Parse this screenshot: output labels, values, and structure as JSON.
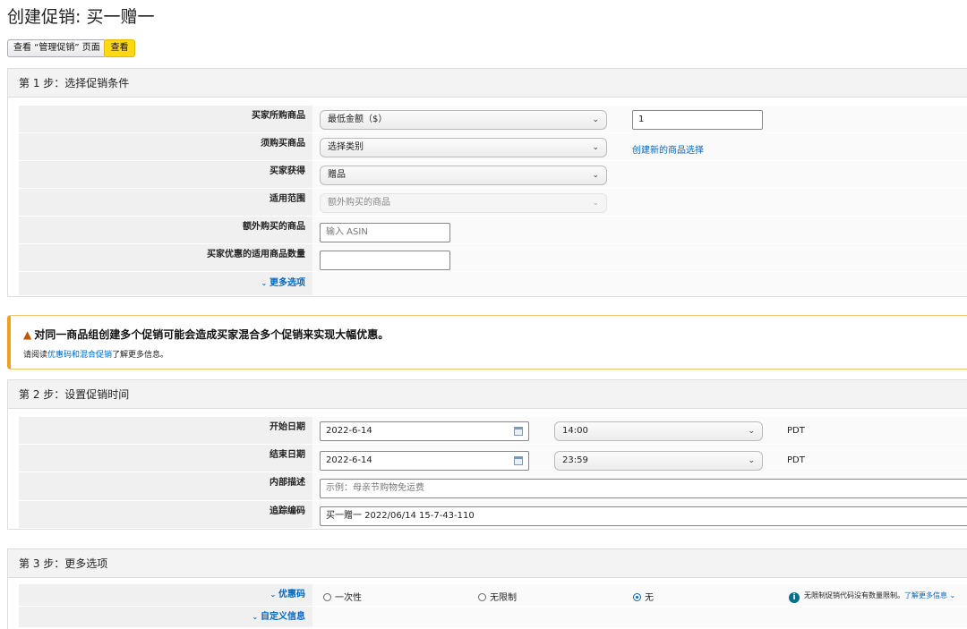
{
  "page_title": "创建促销: 买一赠一",
  "buttons": {
    "view_manage": "查看 “管理促销” 页面",
    "view": "查看"
  },
  "step1": {
    "header": "第 1 步：选择促销条件",
    "rows": {
      "buyer_purchases": {
        "label": "买家所购商品",
        "select": "最低金额（$）",
        "input_value": "1"
      },
      "must_buy": {
        "label": "须购买商品",
        "select": "选择类别",
        "link": "创建新的商品选择"
      },
      "buyer_gets": {
        "label": "买家获得",
        "select": "赠品"
      },
      "applies_to": {
        "label": "适用范围",
        "select": "额外购买的商品"
      },
      "extra_items": {
        "label": "额外购买的商品",
        "placeholder": "输入 ASIN"
      },
      "qty": {
        "label": "买家优惠的适用商品数量",
        "value": ""
      },
      "more_options": "更多选项"
    }
  },
  "warning": {
    "title": "对同一商品组创建多个促销可能会造成买家混合多个促销来实现大幅优惠。",
    "body_prefix": "请阅读",
    "link": "优惠码和混合促销",
    "body_suffix": "了解更多信息。"
  },
  "step2": {
    "header": "第 2 步：设置促销时间",
    "start": {
      "label": "开始日期",
      "date": "2022-6-14",
      "time": "14:00",
      "tz": "PDT"
    },
    "end": {
      "label": "结束日期",
      "date": "2022-6-14",
      "time": "23:59",
      "tz": "PDT"
    },
    "internal": {
      "label": "内部描述",
      "placeholder": "示例：母亲节购物免运费"
    },
    "tracking": {
      "label": "追踪编码",
      "value": "买一赠一 2022/06/14 15-7-43-110"
    }
  },
  "step3": {
    "header": "第 3 步：更多选项",
    "promo_code": {
      "label": "优惠码",
      "options": [
        "一次性",
        "无限制",
        "无"
      ],
      "selected": "无",
      "info_text": "无限制促销代码没有数量限制。",
      "info_link": "了解更多信息"
    },
    "custom_info": "自定义信息"
  },
  "colors": {
    "accent": "#ffd814",
    "link": "#0066c0",
    "warning": "#f0a020"
  }
}
